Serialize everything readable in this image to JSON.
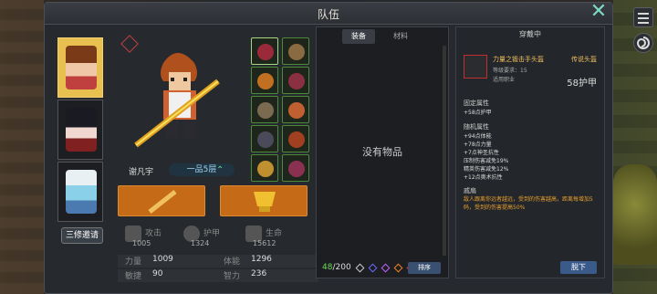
{
  "window": {
    "title": "队伍"
  },
  "characters": [
    {
      "name": "portrait-brown-hair",
      "color": "#b06030"
    },
    {
      "name": "portrait-dark-hair",
      "color": "#2a2a32"
    },
    {
      "name": "portrait-white-hat",
      "color": "#8ad0e8"
    }
  ],
  "invite_label": "三修邀请",
  "hero": {
    "name": "谢凡宇",
    "realm": "一品5层"
  },
  "base_stats": [
    {
      "label": "攻击",
      "value": "1005"
    },
    {
      "label": "护甲",
      "value": "1324"
    },
    {
      "label": "生命",
      "value": "15612"
    }
  ],
  "attributes": [
    {
      "k1": "力量",
      "v1": "1009",
      "k2": "体能",
      "v2": "1296"
    },
    {
      "k1": "敏捷",
      "v1": "90",
      "k2": "智力",
      "v2": "236"
    }
  ],
  "bag": {
    "tab_equipment": "装备",
    "tab_material": "材料",
    "empty_text": "没有物品",
    "count_used": "48",
    "count_total": "/200",
    "sort_label": "排序",
    "gem_colors": [
      "#cccccc",
      "#6a6aff",
      "#c060ff",
      "#f08020",
      "#e03030"
    ]
  },
  "detail": {
    "header": "穿戴中",
    "item_name": "力量之锻击手头盔",
    "rarity": "传说头盔",
    "level_req": "等级要求：15",
    "class_req": "适用职业",
    "armor": "58护甲",
    "fixed_title": "固定属性",
    "fixed_lines": [
      "+58点护甲"
    ],
    "random_title": "随机属性",
    "random_lines": [
      "+94点体能",
      "+78点力量",
      "+7点神圣抗性",
      "压制伤害减免19%",
      "精英伤害减免12%",
      "+12点奥术抗性"
    ],
    "set_title": "戚扇",
    "set_text": "敌人跟离你远者越远，受到的伤害越高，距离每增加5码，受到的伤害提高50%",
    "unequip": "脱下"
  }
}
